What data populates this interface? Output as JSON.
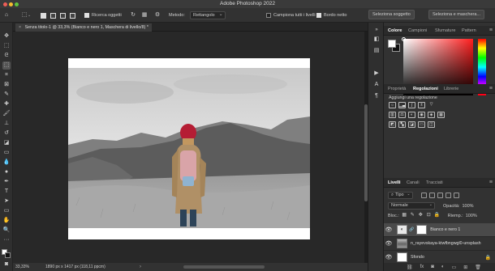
{
  "window": {
    "app_title": "Adobe Photoshop 2022"
  },
  "options_bar": {
    "auto_select_label": "Ricerca oggetti",
    "method_label": "Metodo:",
    "method_value": "Rettangolo",
    "sample_all_layers_label": "Campiona tutti i livelli",
    "hard_edge_label": "Bordo netto",
    "select_subject_button": "Seleziona soggetto",
    "select_and_mask_button": "Seleziona e maschera..."
  },
  "document": {
    "tab_title": "Senza titolo-1 @ 33,3% (Bianco e nero 1, Maschera di livello/8) *",
    "close_symbol": "×"
  },
  "status_bar": {
    "zoom": "33,33%",
    "doc_info": "1890 px x 1417 px (118,11 ppcm)"
  },
  "color_panel": {
    "tabs": [
      "Colore",
      "Campioni",
      "Sfumature",
      "Pattern"
    ],
    "active_tab": 0,
    "foreground": "#ffffff",
    "background": "#111111"
  },
  "adjustments_panel": {
    "tabs": [
      "Proprietà",
      "Regolazioni",
      "Librerie"
    ],
    "active_tab": 1,
    "hint": "Aggiungi una regolazione"
  },
  "layers_panel": {
    "tabs": [
      "Livelli",
      "Canali",
      "Tracciati"
    ],
    "active_tab": 0,
    "filter_kind": "Tipo",
    "blend_mode": "Normale",
    "opacity_label": "Opacità:",
    "opacity_value": "100%",
    "lock_label": "Bloc.:",
    "fill_label": "Riemp.:",
    "fill_value": "100%",
    "layers": [
      {
        "name": "Bianco e nero 1",
        "kind": "adjustment",
        "selected": true
      },
      {
        "name": "n_rayevskaya-ktwfbngwgl0-unsplash",
        "kind": "photo",
        "selected": false
      },
      {
        "name": "Sfondo",
        "kind": "background",
        "selected": false,
        "locked": true
      }
    ]
  }
}
